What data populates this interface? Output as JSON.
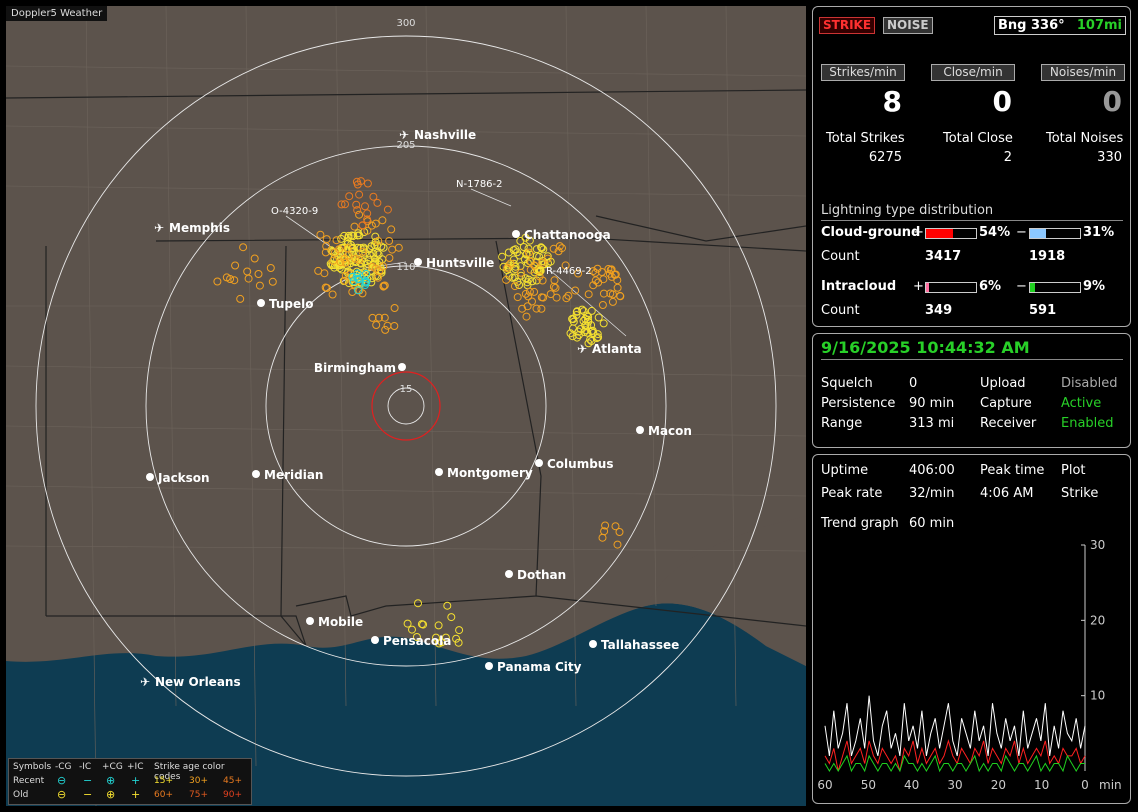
{
  "app_tag": "Doppler5 Weather",
  "map": {
    "ring_labels": [
      "300",
      "205",
      "110",
      "15"
    ],
    "cities": [
      {
        "name": "Nashville",
        "kind": "airport"
      },
      {
        "name": "Memphis",
        "kind": "airport"
      },
      {
        "name": "Chattanooga",
        "kind": "city"
      },
      {
        "name": "Huntsville",
        "kind": "city"
      },
      {
        "name": "Tupelo",
        "kind": "city"
      },
      {
        "name": "Birmingham",
        "kind": "city"
      },
      {
        "name": "Atlanta",
        "kind": "airport"
      },
      {
        "name": "Macon",
        "kind": "city"
      },
      {
        "name": "Jackson",
        "kind": "city"
      },
      {
        "name": "Meridian",
        "kind": "city"
      },
      {
        "name": "Montgomery",
        "kind": "city"
      },
      {
        "name": "Columbus",
        "kind": "city"
      },
      {
        "name": "Dothan",
        "kind": "city"
      },
      {
        "name": "Mobile",
        "kind": "city"
      },
      {
        "name": "Pensacola",
        "kind": "city"
      },
      {
        "name": "Tallahassee",
        "kind": "city"
      },
      {
        "name": "Panama City",
        "kind": "city"
      },
      {
        "name": "New Orleans",
        "kind": "airport"
      }
    ],
    "storm_labels": [
      "O-4320-9",
      "N-1786-2",
      "R-4469-2"
    ]
  },
  "legend": {
    "symbols": "Symbols",
    "neg_cg": "-CG",
    "neg_ic": "-IC",
    "pos_cg": "+CG",
    "pos_ic": "+IC",
    "age_title": "Strike age color codes",
    "recent": "Recent",
    "old": "Old",
    "minus_sym": "−",
    "plus_sym": "+",
    "ages_recent": [
      "15+",
      "30+",
      "45+"
    ],
    "ages_old": [
      "60+",
      "75+",
      "90+"
    ]
  },
  "status": {
    "strike": "STRIKE",
    "noise": "NOISE",
    "bearing_label": "Bng 336°",
    "distance": "107mi"
  },
  "rates": {
    "strikes_label": "Strikes/min",
    "close_label": "Close/min",
    "noises_label": "Noises/min",
    "strikes": "8",
    "close": "0",
    "noises": "0",
    "total_strikes_label": "Total Strikes",
    "total_close_label": "Total Close",
    "total_noises_label": "Total Noises",
    "total_strikes": "6275",
    "total_close": "2",
    "total_noises": "330"
  },
  "distribution": {
    "title": "Lightning type distribution",
    "cg_label": "Cloud-ground",
    "ic_label": "Intracloud",
    "count_label": "Count",
    "plus": "+",
    "minus": "−",
    "cg_pos_pct": "54%",
    "cg_neg_pct": "31%",
    "cg_pos_count": "3417",
    "cg_neg_count": "1918",
    "ic_pos_pct": "6%",
    "ic_neg_pct": "9%",
    "ic_pos_count": "349",
    "ic_neg_count": "591",
    "cg_pos_fill": 0.54,
    "cg_neg_fill": 0.31,
    "ic_pos_fill": 0.06,
    "ic_neg_fill": 0.09,
    "colors": {
      "cg_pos": "#ff0000",
      "cg_neg": "#8cc8ff",
      "ic_pos": "#ff6ea0",
      "ic_neg": "#20d020"
    }
  },
  "info": {
    "datetime": "9/16/2025 10:44:32 AM",
    "squelch_label": "Squelch",
    "squelch": "0",
    "persistence_label": "Persistence",
    "persistence": "90 min",
    "range_label": "Range",
    "range": "313 mi",
    "upload_label": "Upload",
    "upload": "Disabled",
    "capture_label": "Capture",
    "capture": "Active",
    "receiver_label": "Receiver",
    "receiver": "Enabled"
  },
  "stats": {
    "uptime_label": "Uptime",
    "uptime": "406:00",
    "peak_time_label": "Peak time",
    "peak_time": "4:06 AM",
    "plot_label": "Plot",
    "plot": "Strike",
    "peak_rate_label": "Peak rate",
    "peak_rate": "32/min",
    "trend_label": "Trend graph",
    "trend": "60 min"
  },
  "chart_data": {
    "type": "line",
    "xlabel": "min",
    "x_ticks": [
      "60",
      "50",
      "40",
      "30",
      "20",
      "10",
      "0"
    ],
    "y_ticks": [
      "30",
      "20",
      "10"
    ],
    "ylim": [
      0,
      30
    ],
    "xlim": [
      60,
      0
    ],
    "series": [
      {
        "color": "#ffffff",
        "values": [
          6,
          2,
          8,
          3,
          5,
          9,
          2,
          4,
          7,
          3,
          10,
          4,
          2,
          6,
          8,
          3,
          5,
          2,
          9,
          4,
          6,
          3,
          8,
          2,
          5,
          7,
          3,
          6,
          9,
          4,
          2,
          7,
          5,
          3,
          8,
          4,
          6,
          2,
          9,
          5,
          3,
          7,
          4,
          6,
          2,
          8,
          3,
          5,
          7,
          4,
          9,
          2,
          6,
          3,
          8,
          5,
          4,
          7,
          3,
          6
        ]
      },
      {
        "color": "#ff2020",
        "values": [
          2,
          1,
          3,
          0,
          2,
          4,
          1,
          2,
          3,
          1,
          4,
          2,
          1,
          3,
          2,
          1,
          2,
          0,
          3,
          2,
          4,
          1,
          3,
          1,
          2,
          3,
          1,
          2,
          4,
          2,
          1,
          3,
          2,
          1,
          3,
          2,
          4,
          1,
          3,
          2,
          1,
          3,
          2,
          4,
          1,
          3,
          1,
          2,
          3,
          2,
          4,
          1,
          2,
          1,
          3,
          2,
          2,
          3,
          1,
          2
        ]
      },
      {
        "color": "#20d020",
        "values": [
          1,
          0,
          1,
          0,
          1,
          2,
          0,
          1,
          1,
          0,
          2,
          1,
          0,
          1,
          1,
          0,
          1,
          0,
          2,
          1,
          1,
          0,
          1,
          0,
          1,
          2,
          0,
          1,
          1,
          0,
          1,
          1,
          0,
          1,
          2,
          0,
          1,
          0,
          1,
          1,
          0,
          2,
          1,
          0,
          1,
          1,
          0,
          1,
          2,
          0,
          1,
          0,
          1,
          1,
          0,
          2,
          1,
          0,
          1,
          1
        ]
      }
    ]
  }
}
